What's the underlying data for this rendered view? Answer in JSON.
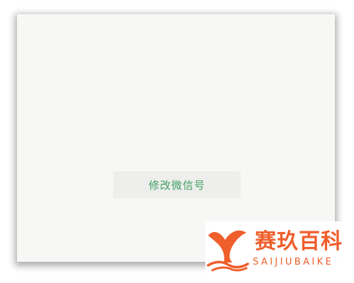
{
  "dialog": {
    "action_label": "修改微信号"
  },
  "watermark": {
    "title": "赛玖百科",
    "subtitle": "SAIJIUBAIKE",
    "brand_color": "#ef5e2b",
    "icon": "whale-tail-icon"
  },
  "colors": {
    "panel_bg": "#f7f7f5",
    "button_bg": "#eeeeec",
    "button_text": "#3f9e63"
  }
}
